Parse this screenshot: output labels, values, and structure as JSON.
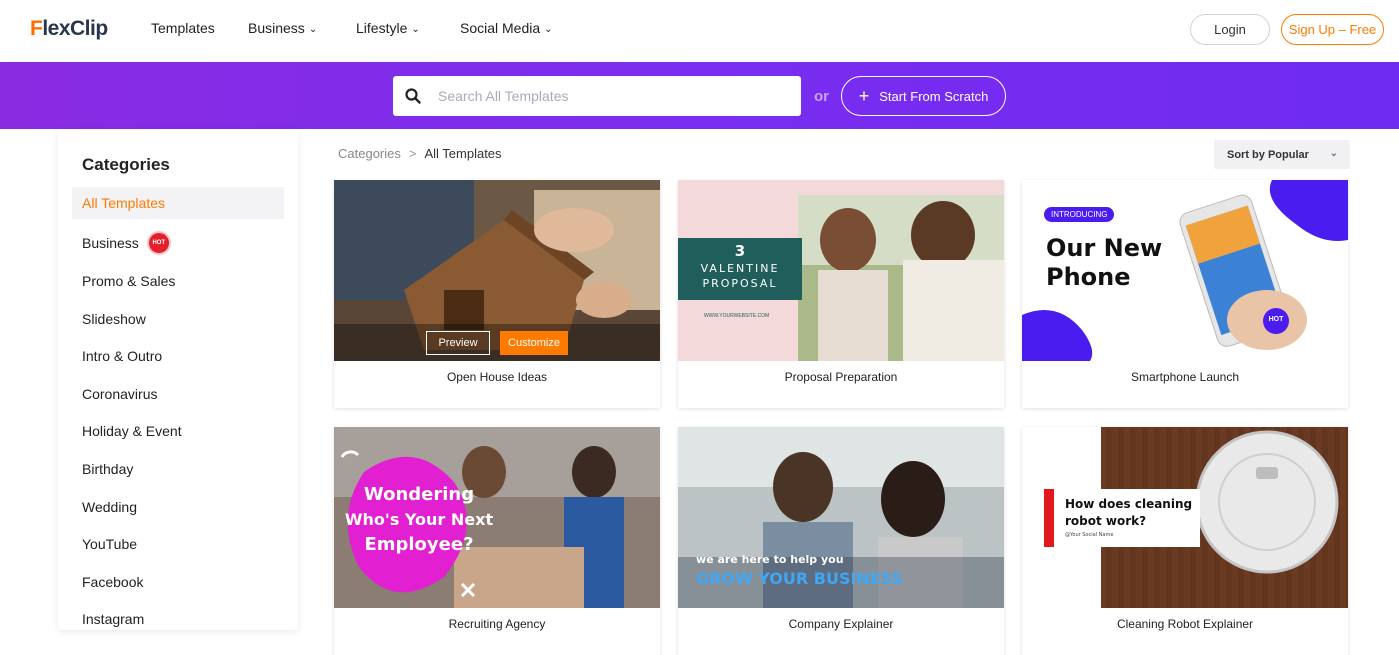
{
  "header": {
    "logo": {
      "f": "F",
      "rest": "lexClip"
    },
    "nav": [
      {
        "label": "Templates",
        "dropdown": false
      },
      {
        "label": "Business",
        "dropdown": true
      },
      {
        "label": "Lifestyle",
        "dropdown": true
      },
      {
        "label": "Social Media",
        "dropdown": true
      }
    ],
    "login": "Login",
    "signup": "Sign Up – Free"
  },
  "banner": {
    "search_placeholder": "Search All Templates",
    "or": "or",
    "scratch": "Start From Scratch",
    "scratch_icon": "plus-icon"
  },
  "sidebar": {
    "title": "Categories",
    "items": [
      {
        "label": "All Templates",
        "active": true
      },
      {
        "label": "Business",
        "hot": "HOT"
      },
      {
        "label": "Promo & Sales"
      },
      {
        "label": "Slideshow"
      },
      {
        "label": "Intro & Outro"
      },
      {
        "label": "Coronavirus"
      },
      {
        "label": "Holiday & Event"
      },
      {
        "label": "Birthday"
      },
      {
        "label": "Wedding"
      },
      {
        "label": "YouTube"
      },
      {
        "label": "Facebook"
      },
      {
        "label": "Instagram"
      }
    ]
  },
  "main": {
    "breadcrumb": {
      "root": "Categories",
      "sep": ">",
      "current": "All Templates"
    },
    "sort": "Sort by Popular",
    "overlay": {
      "preview": "Preview",
      "customize": "Customize"
    },
    "cards": [
      {
        "title": "Open House Ideas"
      },
      {
        "title": "Proposal Preparation",
        "thumb_text": {
          "num": "3",
          "line1": "VALENTINE",
          "line2": "PROPOSAL",
          "url": "WWW.YOURWEBSITE.COM"
        }
      },
      {
        "title": "Smartphone Launch",
        "thumb_text": {
          "tag": "INTRODUCING",
          "line1": "Our New",
          "line2": "Phone",
          "hot": "HOT"
        }
      },
      {
        "title": "Recruiting Agency",
        "thumb_text": {
          "line1": "Wondering",
          "line2": "Who's Your Next",
          "line3": "Employee?"
        }
      },
      {
        "title": "Company Explainer",
        "thumb_text": {
          "line1": "we are here to help you",
          "line2": "GROW YOUR BUSINESS"
        }
      },
      {
        "title": "Cleaning Robot Explainer",
        "thumb_text": {
          "line1": "How does cleaning",
          "line2": "robot work?",
          "handle": "@Your Social Name"
        }
      }
    ]
  },
  "colors": {
    "accent": "#ff7a00",
    "purple": "#7a2df0",
    "hot": "#e4212b"
  }
}
